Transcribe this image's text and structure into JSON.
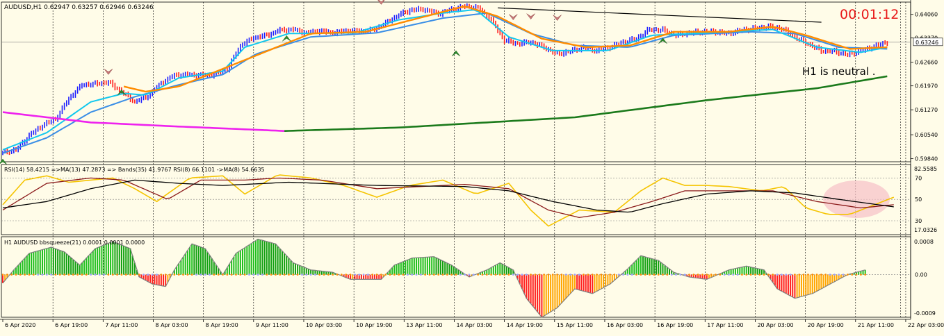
{
  "main_panel": {
    "symbol_info": "AUDUSD,H1  0.62947 0.63257 0.62946 0.63246",
    "timer": "00:01:12",
    "annotation": "H1 is neutral .",
    "current_price": "0.63246",
    "price_label_under": "0.63370"
  },
  "rsi_panel": {
    "header": "RSI(14) 58.4215   =>MA(13) 47.2873   => Bands(35) 41.9767   RSI(8) 66.1101   ->MA(8) 54.6635",
    "max_label": "82.5585",
    "min_label": "17.0326"
  },
  "squeeze_panel": {
    "header": "H1 AUDUSD bbsqueeze(21) 0.0001 0.0001 0.0000",
    "max_label": "0.0008",
    "min_label": "-0.0009"
  },
  "colors": {
    "background": "#fffce8",
    "bull_candle": "#1e1eff",
    "bear_candle": "#ff1a1a",
    "ema_fast": "#12c8ee",
    "ema_slow": "#3a8ee6",
    "ma_orange": "#ff8c00",
    "ma_200_below": "#1b7a1b",
    "ma_200_above": "#ee22ee",
    "trendline": "#000000",
    "rsi": "#f5c400",
    "rsi_ma": "#8b1a1a",
    "rsi_bands": "#000000",
    "squeeze_pos": "#1fbf1f",
    "squeeze_neg": "#ff2020",
    "squeeze_neg_light": "#ffa500",
    "timer": "#e81818"
  },
  "chart_data": [
    {
      "type": "candlestick",
      "title": "AUDUSD,H1",
      "ylim": [
        0.5975,
        0.6442
      ],
      "yticks": [
        "0.64060",
        "0.63370",
        "0.62660",
        "0.61970",
        "0.61270",
        "0.60540",
        "0.59840"
      ],
      "xticks": [
        "6 Apr 2020",
        "6 Apr 19:00",
        "7 Apr 11:00",
        "8 Apr 03:00",
        "8 Apr 19:00",
        "9 Apr 11:00",
        "10 Apr 03:00",
        "10 Apr 19:00",
        "13 Apr 11:00",
        "14 Apr 03:00",
        "14 Apr 19:00",
        "15 Apr 11:00",
        "16 Apr 03:00",
        "16 Apr 19:00",
        "17 Apr 11:00",
        "20 Apr 03:00",
        "20 Apr 19:00",
        "21 Apr 11:00",
        "22 Apr 03:00"
      ],
      "close_path": [
        [
          0,
          0.6002
        ],
        [
          6,
          0.601
        ],
        [
          12,
          0.6052
        ],
        [
          18,
          0.6081
        ],
        [
          24,
          0.61
        ],
        [
          30,
          0.616
        ],
        [
          36,
          0.62
        ],
        [
          42,
          0.6203
        ],
        [
          48,
          0.6208
        ],
        [
          54,
          0.618
        ],
        [
          60,
          0.615
        ],
        [
          66,
          0.6167
        ],
        [
          72,
          0.6205
        ],
        [
          78,
          0.6228
        ],
        [
          84,
          0.623
        ],
        [
          90,
          0.6228
        ],
        [
          96,
          0.623
        ],
        [
          102,
          0.6245
        ],
        [
          108,
          0.6315
        ],
        [
          114,
          0.6338
        ],
        [
          120,
          0.6345
        ],
        [
          126,
          0.636
        ],
        [
          132,
          0.6362
        ],
        [
          138,
          0.6352
        ],
        [
          144,
          0.6358
        ],
        [
          150,
          0.6352
        ],
        [
          156,
          0.6358
        ],
        [
          162,
          0.6357
        ],
        [
          168,
          0.636
        ],
        [
          174,
          0.638
        ],
        [
          180,
          0.6405
        ],
        [
          186,
          0.642
        ],
        [
          192,
          0.642
        ],
        [
          198,
          0.6408
        ],
        [
          204,
          0.642
        ],
        [
          210,
          0.643
        ],
        [
          216,
          0.6425
        ],
        [
          222,
          0.639
        ],
        [
          228,
          0.633
        ],
        [
          234,
          0.632
        ],
        [
          240,
          0.6325
        ],
        [
          246,
          0.631
        ],
        [
          252,
          0.629
        ],
        [
          258,
          0.6298
        ],
        [
          264,
          0.631
        ],
        [
          270,
          0.63
        ],
        [
          276,
          0.631
        ],
        [
          282,
          0.6325
        ],
        [
          288,
          0.6335
        ],
        [
          294,
          0.6362
        ],
        [
          300,
          0.636
        ],
        [
          306,
          0.6345
        ],
        [
          312,
          0.6352
        ],
        [
          318,
          0.6355
        ],
        [
          324,
          0.6355
        ],
        [
          330,
          0.635
        ],
        [
          336,
          0.636
        ],
        [
          342,
          0.6365
        ],
        [
          348,
          0.637
        ],
        [
          354,
          0.6365
        ],
        [
          360,
          0.634
        ],
        [
          366,
          0.632
        ],
        [
          372,
          0.63
        ],
        [
          378,
          0.6298
        ],
        [
          384,
          0.6288
        ],
        [
          390,
          0.63
        ],
        [
          396,
          0.6312
        ],
        [
          402,
          0.6325
        ]
      ],
      "ema_fast": [
        [
          0,
          0.601
        ],
        [
          20,
          0.606
        ],
        [
          40,
          0.615
        ],
        [
          55,
          0.6175
        ],
        [
          65,
          0.617
        ],
        [
          80,
          0.622
        ],
        [
          100,
          0.624
        ],
        [
          110,
          0.631
        ],
        [
          130,
          0.635
        ],
        [
          160,
          0.6352
        ],
        [
          180,
          0.639
        ],
        [
          200,
          0.641
        ],
        [
          215,
          0.642
        ],
        [
          230,
          0.634
        ],
        [
          250,
          0.63
        ],
        [
          275,
          0.63
        ],
        [
          295,
          0.6345
        ],
        [
          320,
          0.6352
        ],
        [
          350,
          0.6362
        ],
        [
          370,
          0.631
        ],
        [
          390,
          0.6295
        ],
        [
          402,
          0.631
        ]
      ],
      "ema_slow": [
        [
          0,
          0.6
        ],
        [
          20,
          0.6045
        ],
        [
          40,
          0.612
        ],
        [
          60,
          0.6165
        ],
        [
          80,
          0.62
        ],
        [
          100,
          0.623
        ],
        [
          115,
          0.629
        ],
        [
          140,
          0.634
        ],
        [
          170,
          0.6352
        ],
        [
          200,
          0.6395
        ],
        [
          220,
          0.641
        ],
        [
          240,
          0.635
        ],
        [
          260,
          0.6315
        ],
        [
          285,
          0.631
        ],
        [
          305,
          0.6345
        ],
        [
          340,
          0.6355
        ],
        [
          360,
          0.635
        ],
        [
          380,
          0.631
        ],
        [
          402,
          0.6305
        ]
      ],
      "ma_orange": [
        [
          55,
          0.6195
        ],
        [
          65,
          0.618
        ],
        [
          80,
          0.6195
        ],
        [
          140,
          0.635
        ],
        [
          165,
          0.6355
        ],
        [
          210,
          0.643
        ],
        [
          225,
          0.64
        ],
        [
          245,
          0.6335
        ],
        [
          265,
          0.631
        ],
        [
          285,
          0.6315
        ],
        [
          305,
          0.6355
        ],
        [
          330,
          0.6355
        ],
        [
          350,
          0.637
        ],
        [
          365,
          0.6345
        ],
        [
          385,
          0.6305
        ],
        [
          402,
          0.631
        ]
      ],
      "ma_long_above": [
        [
          0,
          0.612
        ],
        [
          40,
          0.609
        ],
        [
          80,
          0.6078
        ],
        [
          128,
          0.6065
        ]
      ],
      "ma_long_below": [
        [
          128,
          0.6065
        ],
        [
          180,
          0.6075
        ],
        [
          260,
          0.6105
        ],
        [
          320,
          0.6155
        ],
        [
          370,
          0.619
        ],
        [
          402,
          0.6225
        ]
      ],
      "trendline": [
        [
          225,
          0.6425
        ],
        [
          440,
          0.6375
        ]
      ]
    },
    {
      "type": "line",
      "title": "RSI(14)",
      "ylim": [
        17.0326,
        82.5585
      ],
      "yticks": [
        "70",
        "50",
        "30"
      ],
      "series": [
        {
          "name": "RSI(14)",
          "values": [
            [
              0,
              45
            ],
            [
              10,
              68
            ],
            [
              20,
              72
            ],
            [
              30,
              66
            ],
            [
              50,
              70
            ],
            [
              60,
              60
            ],
            [
              70,
              48
            ],
            [
              85,
              70
            ],
            [
              100,
              72
            ],
            [
              110,
              55
            ],
            [
              125,
              73
            ],
            [
              140,
              70
            ],
            [
              155,
              63
            ],
            [
              170,
              52
            ],
            [
              185,
              63
            ],
            [
              200,
              68
            ],
            [
              215,
              55
            ],
            [
              230,
              65
            ],
            [
              240,
              40
            ],
            [
              248,
              25
            ],
            [
              262,
              40
            ],
            [
              278,
              38
            ],
            [
              290,
              58
            ],
            [
              300,
              70
            ],
            [
              310,
              63
            ],
            [
              320,
              63
            ],
            [
              330,
              62
            ],
            [
              345,
              58
            ],
            [
              355,
              62
            ],
            [
              365,
              42
            ],
            [
              375,
              36
            ],
            [
              385,
              36
            ],
            [
              395,
              44
            ],
            [
              405,
              52
            ]
          ]
        },
        {
          "name": "MA(13)",
          "values": [
            [
              0,
              40
            ],
            [
              20,
              65
            ],
            [
              40,
              70
            ],
            [
              55,
              68
            ],
            [
              75,
              50
            ],
            [
              90,
              68
            ],
            [
              110,
              68
            ],
            [
              125,
              70
            ],
            [
              145,
              68
            ],
            [
              170,
              60
            ],
            [
              190,
              62
            ],
            [
              210,
              64
            ],
            [
              230,
              60
            ],
            [
              248,
              40
            ],
            [
              262,
              33
            ],
            [
              278,
              38
            ],
            [
              295,
              48
            ],
            [
              310,
              58
            ],
            [
              330,
              58
            ],
            [
              350,
              58
            ],
            [
              370,
              48
            ],
            [
              390,
              42
            ],
            [
              405,
              45
            ]
          ]
        },
        {
          "name": "Bands(35)",
          "values": [
            [
              0,
              42
            ],
            [
              20,
              48
            ],
            [
              40,
              60
            ],
            [
              60,
              68
            ],
            [
              80,
              65
            ],
            [
              100,
              63
            ],
            [
              130,
              66
            ],
            [
              170,
              63
            ],
            [
              210,
              62
            ],
            [
              230,
              58
            ],
            [
              250,
              48
            ],
            [
              270,
              40
            ],
            [
              285,
              38
            ],
            [
              300,
              46
            ],
            [
              320,
              55
            ],
            [
              340,
              58
            ],
            [
              360,
              56
            ],
            [
              380,
              50
            ],
            [
              405,
              43
            ]
          ]
        }
      ]
    },
    {
      "type": "bar",
      "title": "bbsqueeze(21)",
      "ylim": [
        -0.0009,
        0.0008
      ],
      "yticks": [
        "0.00"
      ],
      "series": [
        {
          "name": "bbsqueeze(21)",
          "values": [
            [
              0,
              -0.00018
            ],
            [
              5,
              0.0001
            ],
            [
              12,
              0.00045
            ],
            [
              22,
              0.00058
            ],
            [
              28,
              0.00048
            ],
            [
              35,
              0.0002
            ],
            [
              42,
              0.00055
            ],
            [
              50,
              0.0007
            ],
            [
              58,
              0.00055
            ],
            [
              62,
              -5e-05
            ],
            [
              68,
              -0.0002
            ],
            [
              74,
              -0.00025
            ],
            [
              78,
              0.0001
            ],
            [
              86,
              0.00065
            ],
            [
              92,
              0.00055
            ],
            [
              100,
              0.0
            ],
            [
              106,
              0.00045
            ],
            [
              116,
              0.00075
            ],
            [
              124,
              0.00065
            ],
            [
              132,
              0.00025
            ],
            [
              140,
              0.0001
            ],
            [
              150,
              5e-05
            ],
            [
              158,
              -0.0001
            ],
            [
              166,
              -0.0001
            ],
            [
              172,
              -0.0001
            ],
            [
              178,
              0.0002
            ],
            [
              186,
              0.00035
            ],
            [
              196,
              0.00038
            ],
            [
              204,
              0.0002
            ],
            [
              212,
              -5e-05
            ],
            [
              220,
              0.0001
            ],
            [
              226,
              0.00025
            ],
            [
              232,
              0.0001
            ],
            [
              238,
              -0.0005
            ],
            [
              245,
              -0.0009
            ],
            [
              252,
              -0.0007
            ],
            [
              260,
              -0.0003
            ],
            [
              268,
              -0.0004
            ],
            [
              276,
              -0.0002
            ],
            [
              284,
              0.00012
            ],
            [
              290,
              0.0004
            ],
            [
              298,
              0.0003
            ],
            [
              305,
              5e-05
            ],
            [
              312,
              -5e-05
            ],
            [
              320,
              -0.0001
            ],
            [
              330,
              0.0001
            ],
            [
              338,
              0.00018
            ],
            [
              346,
              0.0001
            ],
            [
              352,
              -0.0003
            ],
            [
              360,
              -0.0005
            ],
            [
              368,
              -0.0004
            ],
            [
              376,
              -0.0002
            ],
            [
              384,
              0.0
            ],
            [
              392,
              0.0001
            ]
          ]
        }
      ]
    }
  ]
}
